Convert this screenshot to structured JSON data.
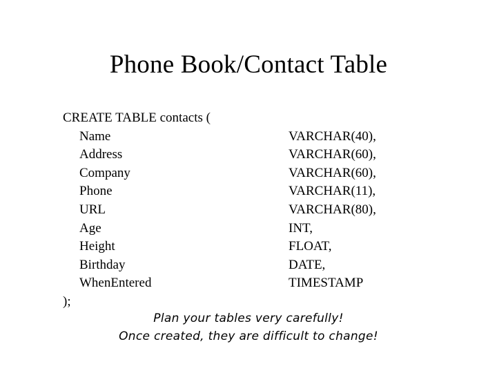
{
  "slide": {
    "title": "Phone Book/Contact Table",
    "text_color": "#000000",
    "background_color": "#ffffff"
  },
  "sql": {
    "header": "CREATE TABLE contacts (",
    "closing": ");",
    "columns": [
      {
        "name": "Name",
        "type": "VARCHAR(40),"
      },
      {
        "name": "Address",
        "type": "VARCHAR(60),"
      },
      {
        "name": "Company",
        "type": "VARCHAR(60),"
      },
      {
        "name": "Phone",
        "type": "VARCHAR(11),"
      },
      {
        "name": "URL",
        "type": "VARCHAR(80),"
      },
      {
        "name": "Age",
        "type": "INT,"
      },
      {
        "name": "Height",
        "type": "FLOAT,"
      },
      {
        "name": "Birthday",
        "type": "DATE,"
      },
      {
        "name": "WhenEntered",
        "type": "TIMESTAMP"
      }
    ]
  },
  "note": {
    "line1": "Plan your tables very carefully!",
    "line2": "Once created, they are difficult to change!"
  }
}
